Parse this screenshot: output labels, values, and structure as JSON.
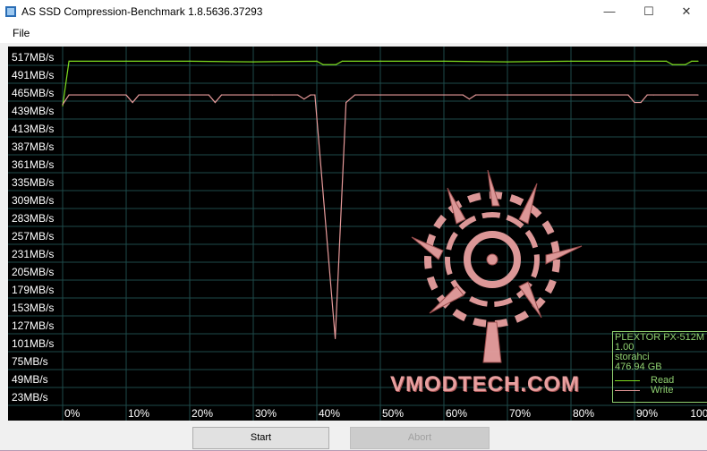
{
  "window": {
    "title": "AS SSD Compression-Benchmark 1.8.5636.37293",
    "minimize": "—",
    "maximize": "☐",
    "close": "✕"
  },
  "menu": {
    "file": "File"
  },
  "legend": {
    "device": "PLEXTOR PX-512M",
    "firmware": "1.00",
    "driver": "storahci",
    "size": "476.94 GB",
    "read": "Read",
    "write": "Write"
  },
  "watermark": "VMODTECH.COM",
  "buttons": {
    "start": "Start",
    "abort": "Abort"
  },
  "colors": {
    "read": "#7ddc1f",
    "write": "#e79a9a",
    "grid": "#1e4a4a"
  },
  "chart_data": {
    "type": "line",
    "title": "",
    "xlabel": "",
    "ylabel": "",
    "x_ticks": [
      "0%",
      "10%",
      "20%",
      "30%",
      "40%",
      "50%",
      "60%",
      "70%",
      "80%",
      "90%",
      "100%"
    ],
    "y_ticks": [
      "517MB/s",
      "491MB/s",
      "465MB/s",
      "439MB/s",
      "413MB/s",
      "387MB/s",
      "361MB/s",
      "335MB/s",
      "309MB/s",
      "283MB/s",
      "257MB/s",
      "231MB/s",
      "205MB/s",
      "179MB/s",
      "153MB/s",
      "127MB/s",
      "101MB/s",
      "75MB/s",
      "49MB/s",
      "23MB/s"
    ],
    "ylim": [
      23,
      517
    ],
    "xlim": [
      0,
      100
    ],
    "series": [
      {
        "name": "Read",
        "x": [
          0,
          1,
          10,
          20,
          30,
          40,
          41,
          43,
          44,
          50,
          60,
          70,
          80,
          90,
          95,
          96,
          98,
          99,
          100
        ],
        "values": [
          445,
          510,
          510,
          510,
          509,
          510,
          505,
          505,
          510,
          510,
          510,
          509,
          510,
          510,
          510,
          505,
          505,
          510,
          510
        ]
      },
      {
        "name": "Write",
        "x": [
          0,
          1,
          10,
          11,
          12,
          20,
          23,
          24,
          25,
          33,
          37,
          38,
          39,
          39.7,
          42.9,
          44.6,
          46,
          50,
          60,
          63,
          64,
          65,
          70,
          80,
          89,
          90,
          91,
          92,
          93,
          100
        ],
        "values": [
          447,
          461,
          461,
          450,
          461,
          461,
          461,
          450,
          461,
          461,
          461,
          455,
          461,
          461,
          107,
          450,
          461,
          461,
          461,
          461,
          455,
          461,
          461,
          461,
          461,
          450,
          450,
          461,
          461,
          461
        ]
      }
    ]
  }
}
